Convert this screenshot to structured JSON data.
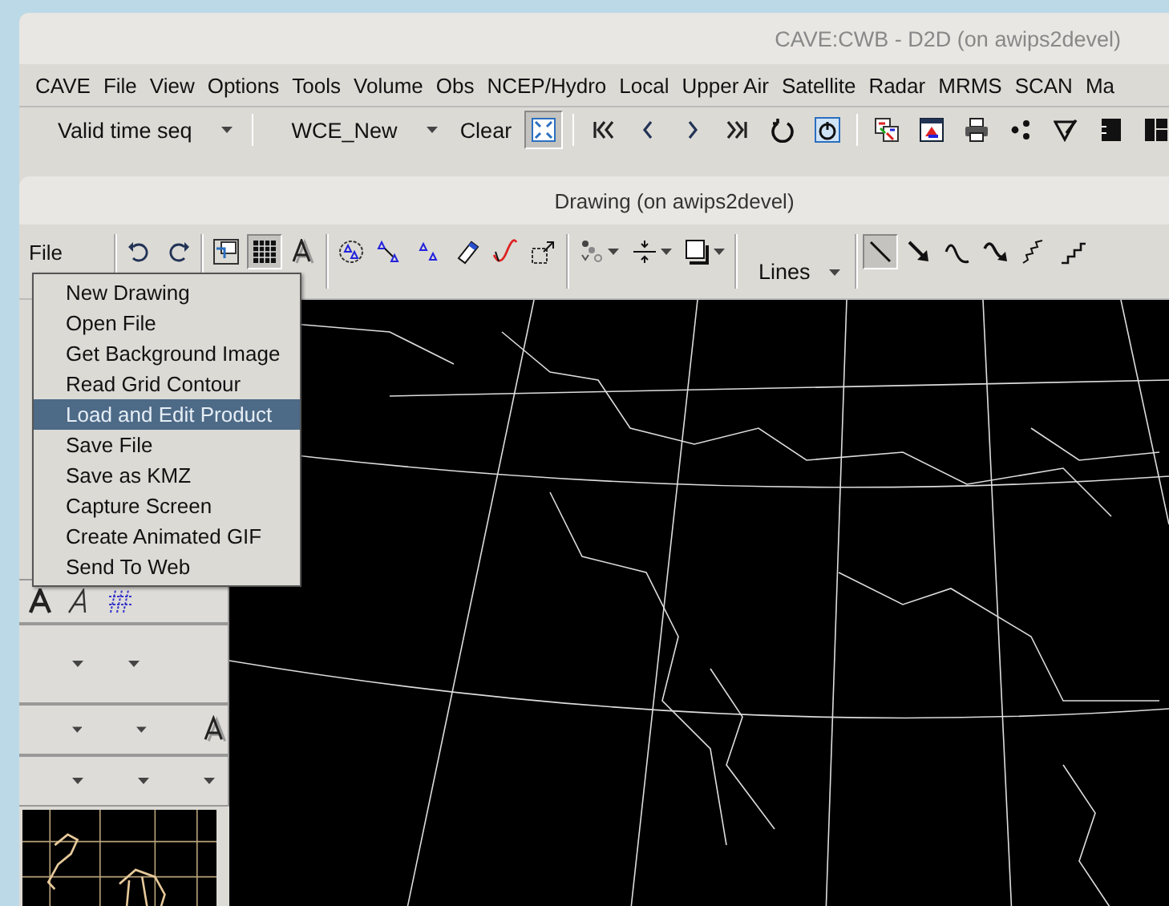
{
  "cave_window": {
    "title": "CAVE:CWB - D2D  (on awips2devel)",
    "menu": [
      "CAVE",
      "File",
      "View",
      "Options",
      "Tools",
      "Volume",
      "Obs",
      "NCEP/Hydro",
      "Local",
      "Upper Air",
      "Satellite",
      "Radar",
      "MRMS",
      "SCAN",
      "Ma"
    ],
    "toolbar": [
      [
        {
          "kind": "dropdown",
          "label": "Valid time seq"
        }
      ],
      [
        {
          "kind": "dropdown",
          "label": "WCE_New"
        },
        {
          "kind": "button",
          "label": "Clear"
        },
        {
          "kind": "fit",
          "pressed": true
        }
      ],
      [
        {
          "kind": "first",
          "pressed": false
        },
        {
          "kind": "prev",
          "pressed": false
        },
        {
          "kind": "next",
          "pressed": false
        },
        {
          "kind": "last",
          "pressed": false
        },
        {
          "kind": "loop",
          "pressed": false
        },
        {
          "kind": "rock",
          "pressed": false
        }
      ],
      [
        {
          "kind": "swap",
          "pressed": false
        },
        {
          "kind": "swap2",
          "pressed": false
        },
        {
          "kind": "print",
          "pressed": false
        },
        {
          "kind": "dots",
          "pressed": false
        },
        {
          "kind": "pen",
          "pressed": false
        },
        {
          "kind": "panel",
          "pressed": false
        },
        {
          "kind": "panel2",
          "pressed": false
        }
      ]
    ]
  },
  "drawing_window": {
    "title": "Drawing  (on awips2devel)",
    "toolbar": [
      [
        {
          "kind": "menu",
          "label": "File"
        }
      ],
      [
        {
          "kind": "undo",
          "pressed": false
        },
        {
          "kind": "redo",
          "pressed": false
        }
      ],
      [
        {
          "kind": "layer",
          "pressed": false
        },
        {
          "kind": "grid",
          "pressed": true
        },
        {
          "kind": "text",
          "pressed": false
        }
      ],
      [
        {
          "kind": "select",
          "pressed": false
        },
        {
          "kind": "move",
          "pressed": false
        },
        {
          "kind": "copy",
          "pressed": false
        },
        {
          "kind": "eraser",
          "pressed": false
        },
        {
          "kind": "curve",
          "pressed": false
        },
        {
          "kind": "resize",
          "pressed": false
        }
      ],
      [
        {
          "kind": "symbols",
          "pressed": false
        },
        {
          "kind": "vertical",
          "pressed": false
        },
        {
          "kind": "square",
          "pressed": false
        }
      ],
      [
        {
          "kind": "dropdown",
          "label": "Lines"
        }
      ],
      [
        {
          "kind": "line",
          "pressed": true
        },
        {
          "kind": "arrow",
          "pressed": false
        },
        {
          "kind": "wave",
          "pressed": false
        },
        {
          "kind": "wavyarrow",
          "pressed": false
        },
        {
          "kind": "zigzag",
          "pressed": false
        },
        {
          "kind": "stairs",
          "pressed": false
        }
      ]
    ],
    "file_menu": [
      {
        "label": "New Drawing",
        "selected": false
      },
      {
        "label": "Open File",
        "selected": false
      },
      {
        "label": "Get Background Image",
        "selected": false
      },
      {
        "label": "Read Grid Contour",
        "selected": false
      },
      {
        "label": "Load and Edit Product",
        "selected": true
      },
      {
        "label": "Save File",
        "selected": false
      },
      {
        "label": "Save as KMZ",
        "selected": false
      },
      {
        "label": "Capture Screen",
        "selected": false
      },
      {
        "label": "Create Animated GIF",
        "selected": false
      },
      {
        "label": "Send To Web",
        "selected": false
      }
    ]
  }
}
